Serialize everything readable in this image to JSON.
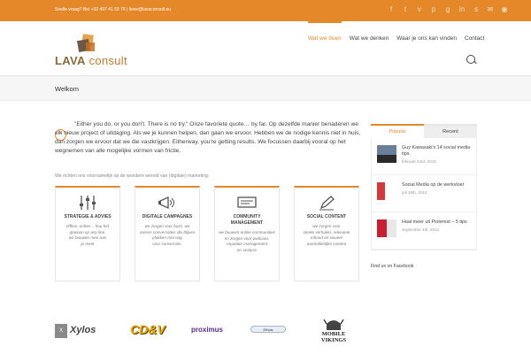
{
  "topbar": {
    "contact": "Snelle vraag? Bel +32 497 41 53 76  |  lieve@lavaconsult.eu",
    "social_icons": [
      "facebook-icon",
      "twitter-icon",
      "vimeo-icon",
      "pinterest-icon",
      "google-plus-icon",
      "linkedin-icon",
      "skype-icon",
      "email-icon",
      "tripadvisor-icon"
    ]
  },
  "logo": {
    "bold": "LAVA",
    "text": "consult"
  },
  "nav": {
    "items": [
      "Wat we doen",
      "Wat we denken",
      "Waar je ons kan vinden",
      "Contact"
    ],
    "active": "Wat we doen"
  },
  "page": {
    "title": "Welkom"
  },
  "quote": "\"Either you do, or you don't. There is no try.\" Onze favoriete quote… by far. Op dezelfde manier benaderen we elk nieuw project of uitdaging. Als we je kunnen helpen, dan gaan we ervoor. Hebben we de nodige kennis niet in huis, dan zorgen we ervoor dat we die vastkrijgen. Eitherway, you're getting results. We focussen daarbij vooral op het wegnemen van alle mogelijke vormen van frictie.",
  "intro": "We richten ons voornamelijk op de wondere wereld van (digitale) marketing:",
  "services": [
    {
      "title": "STRATEGIE & ADVIES",
      "desc": "offline, online… hou het gewoon op any line.\nwe bouwen mee aan\nje merk",
      "icon": "sliders-icon"
    },
    {
      "title": "DIGITALE CAMPAGNES",
      "desc": "we zorgen voor buzz. we voeren conversaties die blijven plakken met oog\nvoor conversies.",
      "icon": "megaphone-icon"
    },
    {
      "title": "COMMUNITY MANAGEMENT",
      "desc": "we bouwen online communities en zorgen voor webcare, reputatie management\nen analyse",
      "icon": "community-icon"
    },
    {
      "title": "SOCIAL CONTENT",
      "desc": "we zorgen voor\nsterke verhalen, relevante inhoud en visueel aantrekkelijke content",
      "icon": "pencil-icon"
    }
  ],
  "sidebar": {
    "tabs": [
      "Popular",
      "Recent"
    ],
    "active_tab": "Popular",
    "posts": [
      {
        "title": "Guy Kawasaki's 14 social media tips.",
        "date": "februari 23rd, 2015"
      },
      {
        "title": "Social Media op de werkvloer",
        "date": "juli 26th, 2012"
      },
      {
        "title": "Haal meer uit Pinterest – 5 tips",
        "date": "september 4th, 2012"
      }
    ],
    "facebook": "Find us on Facebook"
  },
  "partners": {
    "xylos": "Xylos",
    "cdv": "CD&V",
    "proximus": "proximus",
    "ethias": "Ethias",
    "mobile_vikings": "MOBILE VIKINGS"
  },
  "colors": {
    "accent": "#e4882a",
    "topbar": "#e4882a"
  }
}
